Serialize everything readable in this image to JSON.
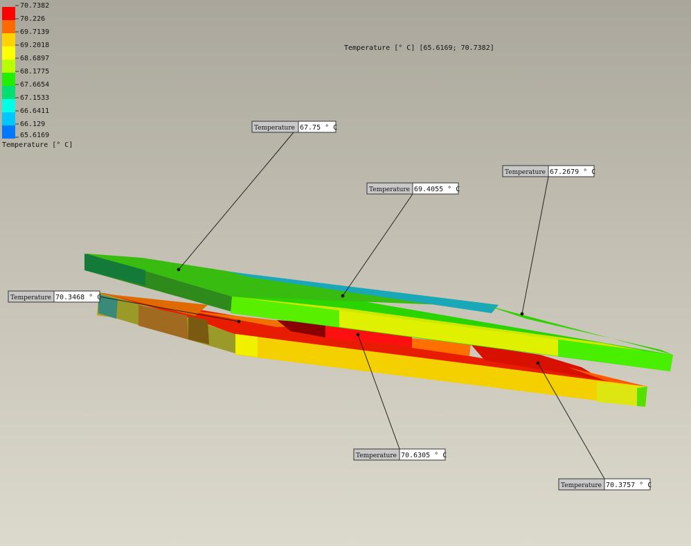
{
  "header": {
    "range_text": "Temperature [° C] [65.6169; 70.7382]"
  },
  "legend": {
    "title": "Temperature [° C]",
    "ticks": [
      "70.7382",
      "70.226",
      "69.7139",
      "69.2018",
      "68.6897",
      "68.1775",
      "67.6654",
      "67.1533",
      "66.6411",
      "66.129",
      "65.6169"
    ],
    "colors": [
      "#ff0000",
      "#ff6a00",
      "#ffd300",
      "#ffff00",
      "#b8ff00",
      "#22ee00",
      "#00e070",
      "#00ffe6",
      "#00c8ff",
      "#0078ff",
      "#0000ff"
    ]
  },
  "probes": [
    {
      "name": "Temperature",
      "value": "67.75 ° C"
    },
    {
      "name": "Temperature",
      "value": "69.4055 ° C"
    },
    {
      "name": "Temperature",
      "value": "67.2679 ° C"
    },
    {
      "name": "Temperature",
      "value": "70.3468 ° C"
    },
    {
      "name": "Temperature",
      "value": "70.6305 ° C"
    },
    {
      "name": "Temperature",
      "value": "70.3757 ° C"
    }
  ]
}
